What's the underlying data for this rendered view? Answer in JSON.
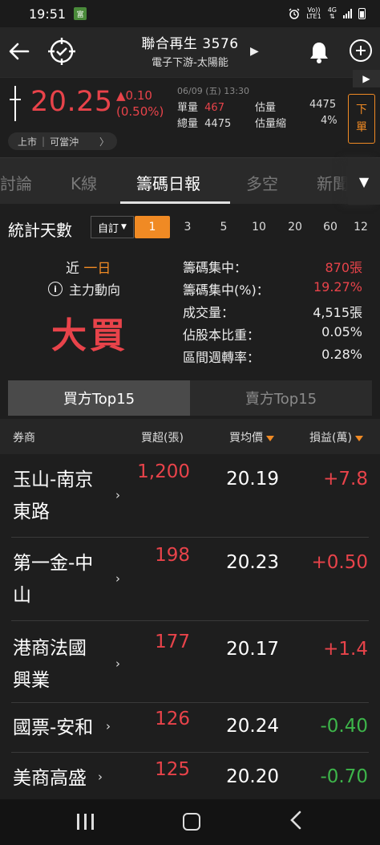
{
  "status_bar": {
    "time": "19:51",
    "app_icon": "rich-icon",
    "network_top": "Vo))",
    "network_label": "LTE1",
    "network_gen": "4G"
  },
  "header": {
    "title": "聯合再生 3576",
    "subtitle": "電子下游-太陽能"
  },
  "quote": {
    "price": "20.25",
    "change": "▲0.10",
    "change_pct": "(0.50%)",
    "datetime": "06/09 (五) 13:30",
    "single_volume_label": "單量",
    "single_volume": "467",
    "est_volume_label": "估量",
    "est_volume": "4475",
    "total_volume_label": "總量",
    "total_volume": "4475",
    "est_shrink_label": "估量縮",
    "est_shrink": "4%",
    "market_status": "上市",
    "day_trade": "可當沖",
    "sell_button": [
      "下",
      "單"
    ]
  },
  "tabs": [
    "討論",
    "K線",
    "籌碼日報",
    "多空",
    "新聞"
  ],
  "active_tab": "籌碼日報",
  "days": {
    "label": "統計天數",
    "custom_label": "自訂",
    "options": [
      "1",
      "3",
      "5",
      "10",
      "20",
      "60",
      "12"
    ],
    "selected": "1"
  },
  "summary": {
    "near_prefix": "近",
    "near_period": "一日",
    "main_force_label": "主力動向",
    "verdict": "大買",
    "metrics": [
      {
        "label": "籌碼集中：",
        "value": "870張",
        "red": true
      },
      {
        "label": "籌碼集中(%)：",
        "value": "19.27%",
        "red": true
      },
      {
        "label": "成交量：",
        "value": "4,515張",
        "red": false
      },
      {
        "label": "佔股本比重：",
        "value": "0.05%",
        "red": false
      },
      {
        "label": "區間週轉率：",
        "value": "0.28%",
        "red": false
      }
    ]
  },
  "toggle": {
    "buy_label": "買方Top15",
    "sell_label": "賣方Top15"
  },
  "table": {
    "headers": {
      "broker": "券商",
      "net_buy": "買超(張)",
      "avg_price": "買均價",
      "pnl": "損益(萬)"
    },
    "rows": [
      {
        "broker_line1": "玉山-南京",
        "broker_line2": "東路",
        "net": "1,200",
        "avg": "20.19",
        "pnl": "+7.8",
        "pnl_sign": "pos"
      },
      {
        "broker_line1": "第一金-中",
        "broker_line2": "山",
        "net": "198",
        "avg": "20.23",
        "pnl": "+0.50",
        "pnl_sign": "pos"
      },
      {
        "broker_line1": "港商法國",
        "broker_line2": "興業",
        "net": "177",
        "avg": "20.17",
        "pnl": "+1.4",
        "pnl_sign": "pos"
      },
      {
        "broker_line1": "國票-安和",
        "broker_line2": "",
        "net": "126",
        "avg": "20.24",
        "pnl": "-0.40",
        "pnl_sign": "neg"
      },
      {
        "broker_line1": "美商高盛",
        "broker_line2": "",
        "net": "125",
        "avg": "20.20",
        "pnl": "-0.70",
        "pnl_sign": "neg"
      }
    ]
  },
  "colors": {
    "up": "#e8434a",
    "down": "#3db54a",
    "accent": "#f08a24",
    "background": "#1e1e1e"
  }
}
